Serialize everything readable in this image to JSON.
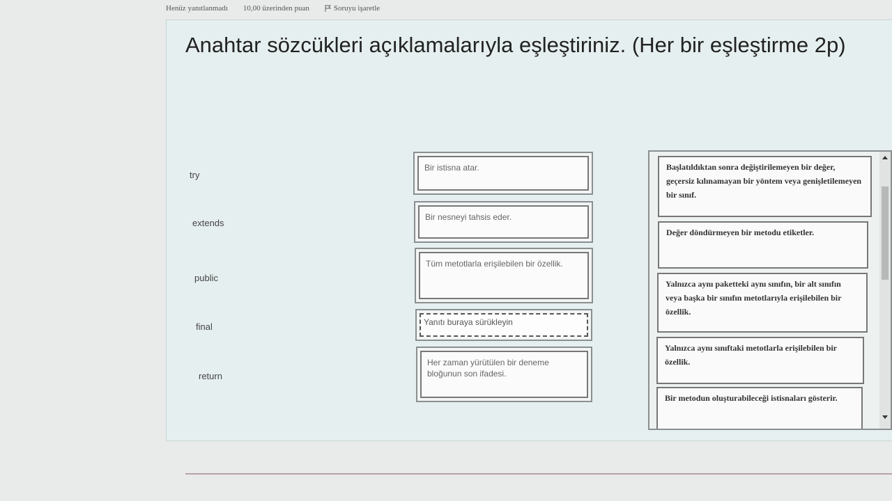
{
  "question_info": {
    "status": "Henüz yanıtlanmadı",
    "points": "10,00 üzerinden puan",
    "flag_label": "Soruyu işaretle"
  },
  "question": {
    "text": "Anahtar sözcükleri açıklamalarıyla eşleştiriniz. (Her bir eşleştirme 2p)"
  },
  "keywords": [
    "try",
    "extends",
    "public",
    "final",
    "return"
  ],
  "answers": [
    {
      "text": "Bir istisna atar.",
      "filled": true
    },
    {
      "text": "Bir nesneyi tahsis eder.",
      "filled": true
    },
    {
      "text": "Tüm metotlarla erişilebilen bir özellik.",
      "filled": true
    },
    {
      "text": "Yanıtı buraya sürükleyin",
      "filled": false
    },
    {
      "text": "Her zaman yürütülen bir deneme bloğunun son ifadesi.",
      "filled": true
    }
  ],
  "bank": {
    "items": [
      "Başlatıldıktan sonra değiştirilemeyen bir değer, geçersiz kılınamayan bir yöntem veya genişletilemeyen bir sınıf.",
      "Değer döndürmeyen bir metodu etiketler.",
      "Yalnızca aynı paketteki aynı sınıfın, bir alt sınıfın veya başka bir sınıfın metotlarıyla erişilebilen bir özellik.",
      "Yalnızca aynı sınıftaki metotlarla erişilebilen bir özellik.",
      "Bir metodun oluşturabileceği istisnaları gösterir."
    ]
  }
}
